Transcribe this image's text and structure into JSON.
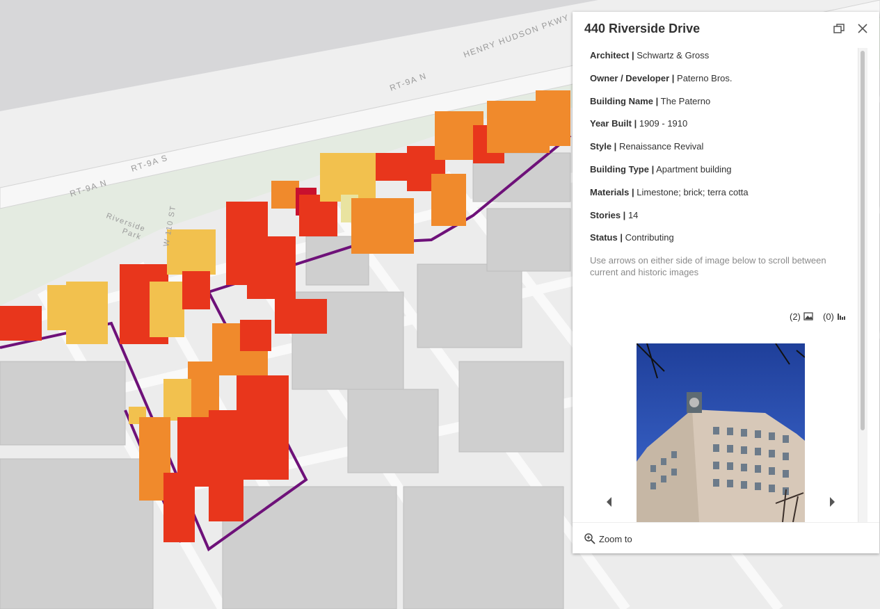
{
  "map": {
    "road_labels": [
      "HENRY HUDSON PKWY",
      "RT-9A N",
      "RT-9A S",
      "RT-9A N"
    ],
    "park_label_line1": "Riverside",
    "park_label_line2": "Park",
    "street_label": "W 110 ST",
    "colors": {
      "sky": "#d7d7d9",
      "park": "#e4ebe1",
      "ground": "#ececec",
      "road": "#f9f9f9",
      "district_boundary": "#6e1179",
      "bldg_dark_red": "#c8102e",
      "bldg_red": "#e8361c",
      "bldg_orange": "#f08a2c",
      "bldg_yellow": "#f2c14e",
      "bldg_light_yellow": "#e9e3a0",
      "bldg_gray": "#cfcfcf"
    }
  },
  "popup": {
    "title": "440 Riverside Drive",
    "attributes": [
      {
        "label": "Architect |",
        "value": "Schwartz & Gross"
      },
      {
        "label": "Owner / Developer |",
        "value": "Paterno Bros."
      },
      {
        "label": "Building Name |",
        "value": "The Paterno"
      },
      {
        "label": "Year Built |",
        "value": "1909 - 1910"
      },
      {
        "label": "Style |",
        "value": "Renaissance Revival"
      },
      {
        "label": "Building Type |",
        "value": "Apartment building"
      },
      {
        "label": "Materials |",
        "value": "Limestone; brick; terra cotta"
      },
      {
        "label": "Stories |",
        "value": "14"
      },
      {
        "label": "Status |",
        "value": "Contributing"
      }
    ],
    "hint": "Use arrows on either side of image below to scroll between current and historic images",
    "image_count": "(2)",
    "chart_count": "(0)",
    "icons": {
      "dock": "dock-icon",
      "close": "close-icon",
      "images": "image-icon",
      "charts": "bar-chart-icon",
      "prev": "caret-left-icon",
      "next": "caret-right-icon",
      "zoom": "zoom-in-icon"
    },
    "zoom_to_label": "Zoom to"
  }
}
